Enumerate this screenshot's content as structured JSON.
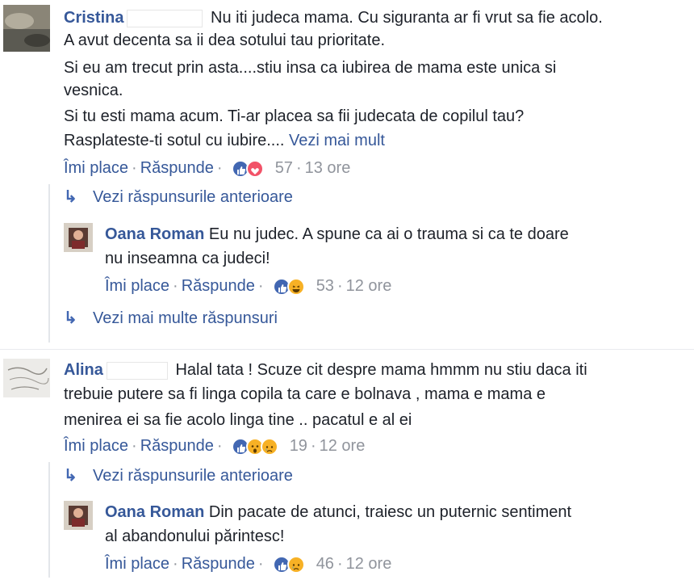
{
  "comments": [
    {
      "author_first": "Cristina",
      "lines": [
        "Nu iti judeca mama. Cu siguranta ar fi vrut sa fie acolo.",
        "A avut decenta sa ii dea sotului tau prioritate.",
        "Si eu am trecut prin asta....stiu insa ca iubirea de mama este unica si",
        "vesnica.",
        "Si tu esti mama acum. Ti-ar placea sa fii judecata de copilul tau?",
        "Rasplateste-ti sotul cu iubire...."
      ],
      "see_more": "Vezi mai mult",
      "like_label": "Îmi place",
      "reply_label": "Răspunde",
      "reaction_count": "57",
      "time": "13 ore",
      "reactions": [
        "like",
        "love"
      ]
    },
    {
      "author_first": "Alina",
      "lines": [
        "Halal tata ! Scuze cit despre mama hmmm nu stiu daca iti",
        "trebuie putere sa fi linga copila ta care e bolnava , mama e mama e",
        "menirea ei sa fie acolo linga tine .. pacatul e al ei"
      ],
      "like_label": "Îmi place",
      "reply_label": "Răspunde",
      "reaction_count": "19",
      "time": "12 ore",
      "reactions": [
        "like",
        "wow",
        "sad"
      ]
    }
  ],
  "replies": [
    {
      "author": "Oana Roman",
      "lines": [
        "Eu nu judec. A spune ca ai o trauma si ca te doare",
        "nu inseamna ca judeci!"
      ],
      "like_label": "Îmi place",
      "reply_label": "Răspunde",
      "reaction_count": "53",
      "time": "12 ore",
      "reactions": [
        "like",
        "haha"
      ]
    },
    {
      "author": "Oana Roman",
      "lines": [
        "Din pacate de atunci, traiesc un puternic sentiment",
        "al abandonului părintesc!"
      ],
      "like_label": "Îmi place",
      "reply_label": "Răspunde",
      "reaction_count": "46",
      "time": "12 ore",
      "reactions": [
        "like",
        "sad"
      ]
    }
  ],
  "links": {
    "previous_replies": "Vezi răspunsurile anterioare",
    "more_replies": "Vezi mai multe răspunsuri"
  },
  "colors": {
    "link": "#365899",
    "meta": "#90949c",
    "like": "#4267b2",
    "love": "#f25268",
    "yellow": "#f7b125"
  }
}
